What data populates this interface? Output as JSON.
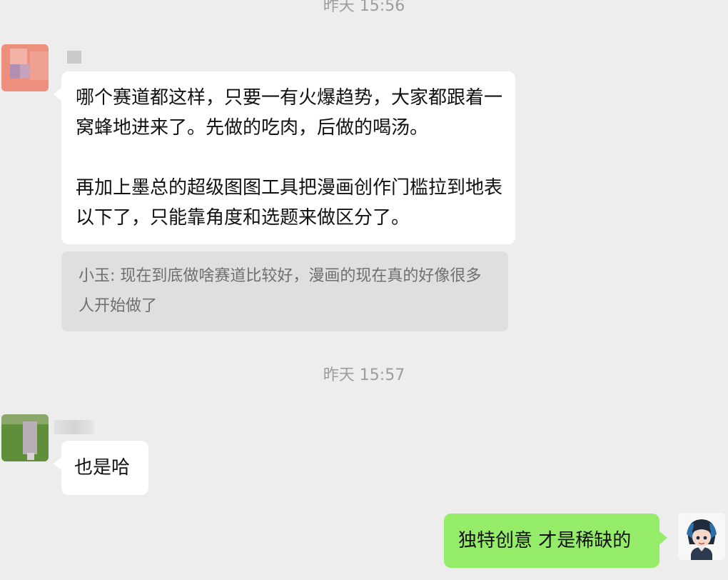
{
  "chat": {
    "timestamp_1": "昨天 15:56",
    "timestamp_2": "昨天 15:57",
    "message_1": {
      "paragraph_1": "哪个赛道都这样，只要一有火爆趋势，大家都跟着一窝蜂地进来了。先做的吃肉，后做的喝汤。",
      "paragraph_2": "再加上墨总的超级图图工具把漫画创作门槛拉到地表以下了，只能靠角度和选题来做区分了。"
    },
    "quote_1": "小玉: 现在到底做啥赛道比较好，漫画的现在真的好像很多人开始做了",
    "message_2": "也是哈",
    "message_3": "独特创意 才是稀缺的"
  },
  "colors": {
    "background": "#ededed",
    "incoming_bubble": "#ffffff",
    "outgoing_bubble": "#95ec69",
    "quote_background": "#dfdfdf",
    "timestamp_text": "#9d9d9d"
  },
  "icons": {
    "sender_1_avatar": "blurred-avatar",
    "sender_2_avatar": "blurred-avatar",
    "self_avatar": "cartoon-character-avatar"
  }
}
